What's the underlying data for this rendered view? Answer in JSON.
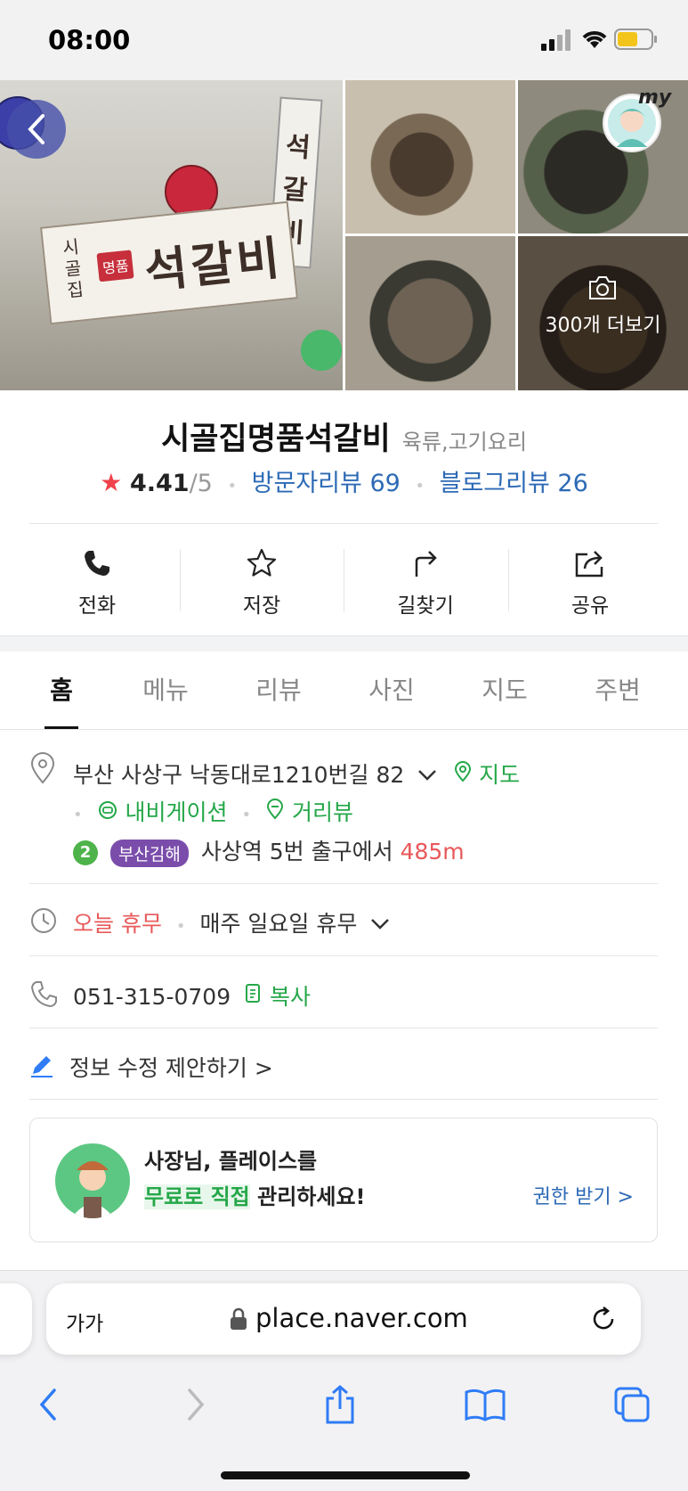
{
  "status_bar": {
    "time": "08:00"
  },
  "photos": {
    "more_label": "300개 더보기",
    "back_label": "back",
    "my_label": "my"
  },
  "place": {
    "name": "시골집명품석갈비",
    "category": "육류,고기요리",
    "rating": "4.41",
    "rating_max": "/5",
    "visitor_reviews": "방문자리뷰 69",
    "blog_reviews": "블로그리뷰 26"
  },
  "actions": [
    {
      "label": "전화",
      "icon": "phone-icon"
    },
    {
      "label": "저장",
      "icon": "star-outline-icon"
    },
    {
      "label": "길찾기",
      "icon": "directions-icon"
    },
    {
      "label": "공유",
      "icon": "share-icon"
    }
  ],
  "tabs": [
    "홈",
    "메뉴",
    "리뷰",
    "사진",
    "지도",
    "주변"
  ],
  "info": {
    "address": "부산 사상구 낙동대로1210번길 82",
    "map_link": "지도",
    "navigation_link": "내비게이션",
    "street_view_link": "거리뷰",
    "subway_line": "2",
    "station_line_name": "부산김해",
    "station_text": "사상역 5번 출구에서",
    "distance": "485m",
    "today_status": "오늘 휴무",
    "hours_text": "매주 일요일 휴무",
    "phone": "051-315-0709",
    "copy_label": "복사",
    "suggest_edit": "정보 수정 제안하기 >"
  },
  "owner_card": {
    "line1": "사장님, 플레이스를",
    "line2_highlight": "무료로 직접",
    "line2_rest": " 관리하세요!",
    "action": "권한 받기 >"
  },
  "browser": {
    "text_size": "가가",
    "url": "place.naver.com"
  },
  "colors": {
    "accent_green": "#25a749",
    "link_blue": "#2d6ab5",
    "alert_red": "#e8585a",
    "star_red": "#f0424c",
    "ios_blue": "#2f7cf6"
  }
}
